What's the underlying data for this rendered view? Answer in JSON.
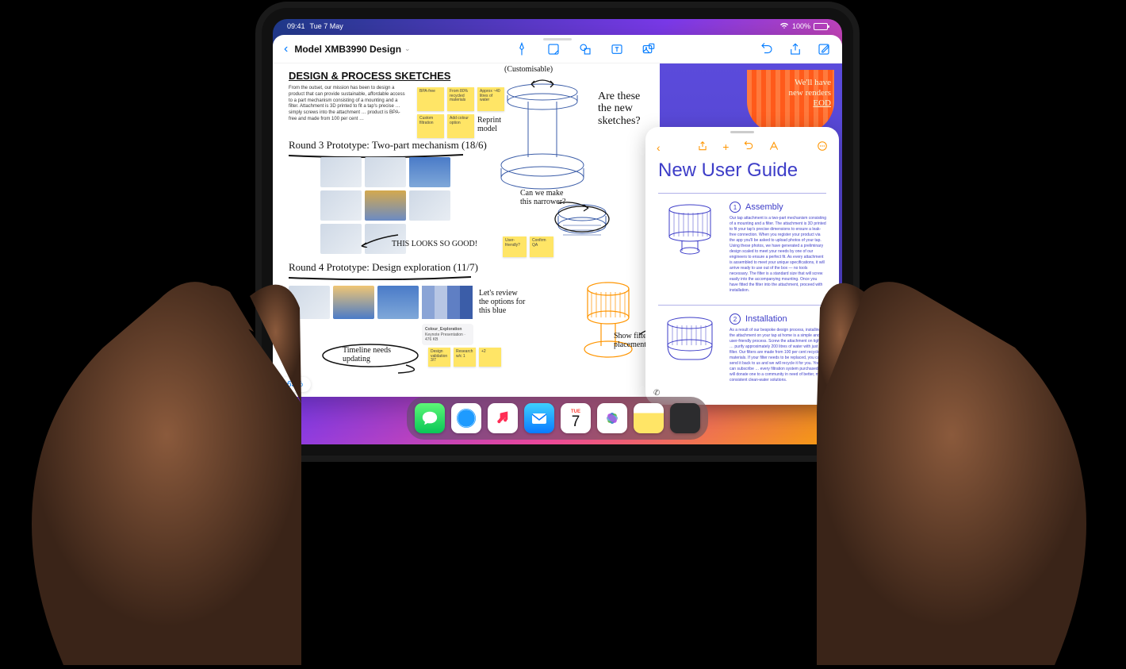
{
  "status": {
    "time": "09:41",
    "date": "Tue 7 May",
    "battery": "100%"
  },
  "freeform": {
    "title": "Model XMB3990 Design",
    "section_heading": "DESIGN & PROCESS SKETCHES",
    "intro_text": "From the outset, our mission has been to design a product that can provide sustainable, affordable access to a part mechanism consisting of a mounting and a filter. Attachment is 3D printed to fit a tap's precise … simply screws into the attachment … product is BPA-free and made from 100 per cent …",
    "round3_label": "Round 3 Prototype: Two-part mechanism  (18/6)",
    "round4_label": "Round 4 Prototype: Design exploration  (11/7)",
    "looks_good": "THIS  LOOKS  SO  GOOD!",
    "customisable": "(Customisable)",
    "are_these": "Are these the new sketches?",
    "can_we": "Can we make this narrower?",
    "lets_review": "Let's review the options for this blue",
    "show_filter": "Show filter placement",
    "timeline_note": "Timeline needs updating",
    "stickies": {
      "bpa": "BPA-free",
      "recycled": "From 80% recycled materials",
      "capacity": "Approx ~40 litres of water",
      "custom": "Custom filtration",
      "add_color": "Add colour option",
      "reprint": "Reprint model",
      "user_friendly": "User-friendly?",
      "confirm_qa": "Confirm QA",
      "design_validation": "Design validation 3/7",
      "research_w1": "Research w/c 1",
      "plus2": "+2"
    },
    "file": {
      "name": "Colour_Exploration",
      "meta": "Keynote Presentation · 476 KB"
    },
    "zoom": "63%"
  },
  "sidepanel": {
    "note_line1": "We'll have",
    "note_line2": "new renders",
    "note_line3": "EOD"
  },
  "notes": {
    "title": "New User Guide",
    "steps": [
      {
        "num": "1",
        "heading": "Assembly",
        "body": "Our tap attachment is a two-part mechanism consisting of a mounting and a filter. The attachment is 3D printed to fit your tap's precise dimensions to ensure a leak-free connection. When you register your product via the app you'll be asked to upload photos of your tap. Using these photos, we have generated a preliminary design scaled to meet your needs by one of our engineers to ensure a perfect fit. As every attachment is assembled to meet your unique specifications, it will arrive ready to use out of the box — no tools necessary. The filter is a standard size that will screw easily into the accompanying mounting. Once you have fitted the filter into the attachment, proceed with installation."
      },
      {
        "num": "2",
        "heading": "Installation",
        "body": "As a result of our bespoke design process, installing the attachment on your tap at home is a simple and user-friendly process. Screw the attachment on tightly … purify approximately 200 litres of water with just one filter. Our filters are made from 100 per cent recycled materials. If your filter needs to be replaced, you can send it back to us and we will recycle it for you. You can subscribe … every filtration system purchased, we will donate one to a community in need of better, more consistent clean-water solutions."
      }
    ]
  },
  "dock": {
    "calendar_day": "TUE",
    "calendar_num": "7"
  },
  "colors": {
    "primary_blue": "#007aff",
    "notes_orange": "#ff9500",
    "guide_indigo": "#3d3dc8"
  }
}
